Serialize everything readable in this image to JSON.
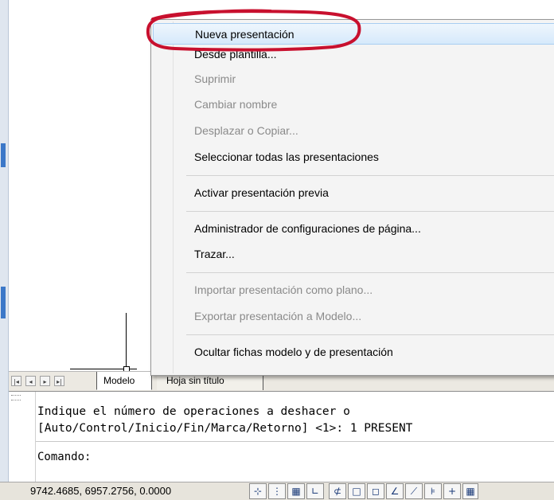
{
  "context_menu": {
    "items": [
      {
        "label": "Nueva presentación",
        "enabled": true,
        "highlighted": true
      },
      {
        "label": "Desde plantilla...",
        "enabled": true
      },
      {
        "label": "Suprimir",
        "enabled": false
      },
      {
        "label": "Cambiar nombre",
        "enabled": false
      },
      {
        "label": "Desplazar o Copiar...",
        "enabled": false
      },
      {
        "label": "Seleccionar todas las presentaciones",
        "enabled": true
      },
      {
        "label": "Activar presentación previa",
        "enabled": true
      },
      {
        "label": "Administrador de configuraciones de página...",
        "enabled": true
      },
      {
        "label": "Trazar...",
        "enabled": true
      },
      {
        "label": "Importar presentación como plano...",
        "enabled": false
      },
      {
        "label": "Exportar presentación a Modelo...",
        "enabled": false
      },
      {
        "label": "Ocultar fichas modelo y de presentación",
        "enabled": true
      }
    ]
  },
  "layout_tabs": {
    "nav": [
      "first-icon",
      "prev-icon",
      "next-icon",
      "last-icon"
    ],
    "model": "Modelo",
    "sheet": "Hoja sin título"
  },
  "command_line": {
    "history": [
      "Indique el número de operaciones a deshacer o",
      "[Auto/Control/Inicio/Fin/Marca/Retorno] <1>: 1 PRESENT"
    ],
    "prompt": "Comando:"
  },
  "status_bar": {
    "coordinates": "9742.4685, 6957.2756, 0.0000",
    "toggles": [
      "snap-icon",
      "grid-icon",
      "dot-grid-icon",
      "ortho-icon",
      "polar-icon",
      "osnap-icon",
      "3d-osnap-icon",
      "otrack-icon",
      "ducs-icon",
      "dyn-icon",
      "lineweight-icon",
      "more-icon"
    ]
  },
  "colors": {
    "highlight": "#d6e9fb",
    "annotation": "#c8102e",
    "disabled": "#8a8a8a"
  }
}
